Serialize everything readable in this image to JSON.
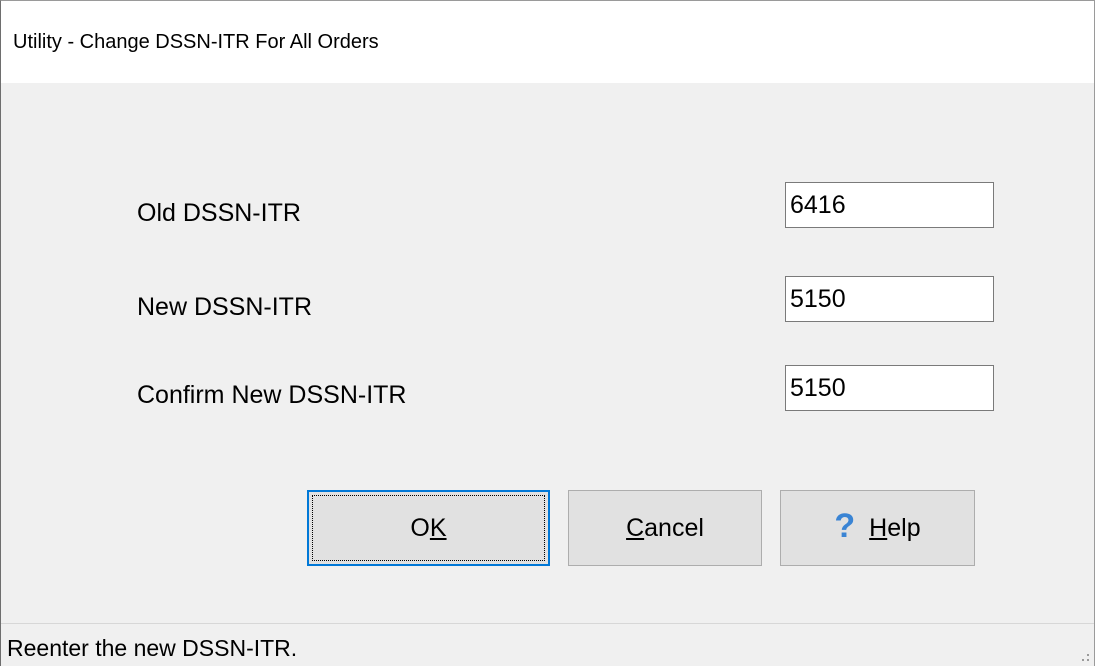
{
  "window": {
    "title": "Utility - Change DSSN-ITR For All Orders"
  },
  "form": {
    "old_label": "Old DSSN-ITR",
    "old_value": "6416",
    "new_label": "New DSSN-ITR",
    "new_value": "5150",
    "confirm_label": "Confirm New DSSN-ITR",
    "confirm_value": "5150"
  },
  "buttons": {
    "ok_prefix": "O",
    "ok_mnemonic": "K",
    "cancel_mnemonic": "C",
    "cancel_rest": "ancel",
    "help_icon": "?",
    "help_mnemonic": "H",
    "help_rest": "elp"
  },
  "status": {
    "message": "Reenter the new DSSN-ITR."
  },
  "colors": {
    "window_bg": "#f0f0f0",
    "title_bg": "#ffffff",
    "button_bg": "#e1e1e1",
    "focus_border": "#0078d7",
    "help_icon": "#3a84d4"
  },
  "icons": {
    "help": "question-mark-icon",
    "resize_grip": "size-grip-icon"
  }
}
